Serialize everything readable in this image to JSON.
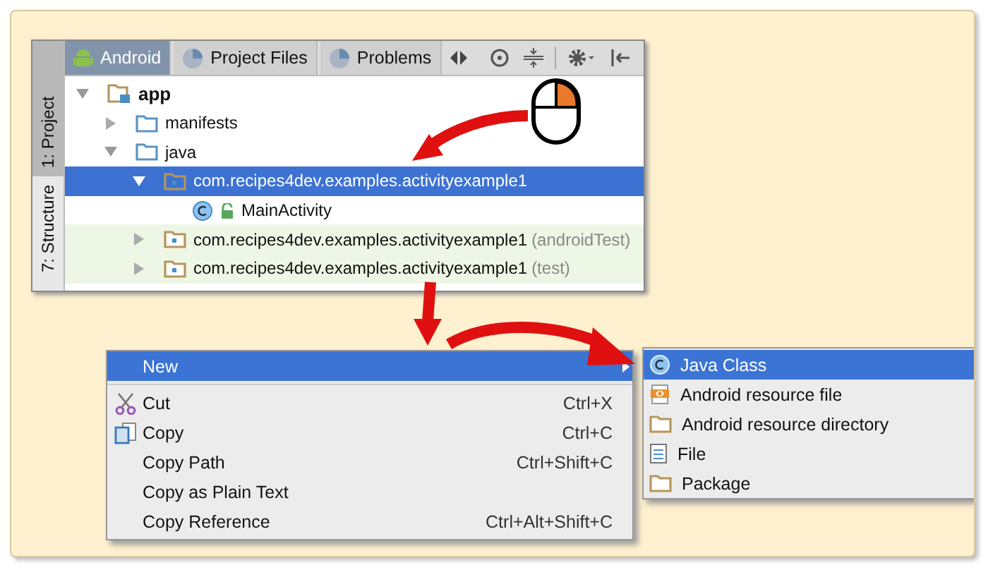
{
  "project_panel": {
    "side_tabs": [
      {
        "label": "1: Project",
        "selected": true
      },
      {
        "label": "7: Structure",
        "selected": false
      }
    ],
    "tabs": [
      {
        "label": "Android",
        "selected": true
      },
      {
        "label": "Project Files",
        "selected": false
      },
      {
        "label": "Problems",
        "selected": false
      }
    ],
    "tree": [
      {
        "label": "app",
        "kind": "module",
        "expanded": true,
        "selected": false,
        "children": [
          {
            "label": "manifests",
            "kind": "folder",
            "expanded": false,
            "selected": false
          },
          {
            "label": "java",
            "kind": "folder",
            "expanded": true,
            "selected": false,
            "children": [
              {
                "label": "com.recipes4dev.examples.activityexample1",
                "kind": "package",
                "expanded": true,
                "selected": true,
                "children": [
                  {
                    "label": "MainActivity",
                    "kind": "class",
                    "selected": false
                  }
                ]
              },
              {
                "label": "com.recipes4dev.examples.activityexample1",
                "suffix": "(androidTest)",
                "kind": "test_package",
                "expanded": false,
                "selected": false
              },
              {
                "label": "com.recipes4dev.examples.activityexample1",
                "suffix": "(test)",
                "kind": "test_package",
                "expanded": false,
                "selected": false
              }
            ]
          }
        ]
      }
    ]
  },
  "context_menu": [
    {
      "label": "New",
      "kind": "plain",
      "submenu": true,
      "selected": true
    },
    {
      "label": "Cut",
      "kind": "scissors",
      "shortcut": "Ctrl+X",
      "submenu": false,
      "selected": false
    },
    {
      "label": "Copy",
      "kind": "copy",
      "shortcut": "Ctrl+C",
      "submenu": false,
      "selected": false
    },
    {
      "label": "Copy Path",
      "kind": "plain",
      "shortcut": "Ctrl+Shift+C",
      "submenu": false,
      "selected": false
    },
    {
      "label": "Copy as Plain Text",
      "kind": "plain",
      "submenu": false,
      "selected": false
    },
    {
      "label": "Copy Reference",
      "kind": "plain",
      "shortcut": "Ctrl+Alt+Shift+C",
      "submenu": false,
      "selected": false
    }
  ],
  "submenu": [
    {
      "label": "Java Class",
      "kind": "class",
      "selected": true
    },
    {
      "label": "Android resource file",
      "kind": "resource",
      "selected": false
    },
    {
      "label": "Android resource directory",
      "kind": "folder",
      "selected": false
    },
    {
      "label": "File",
      "kind": "file",
      "selected": false
    },
    {
      "label": "Package",
      "kind": "folder",
      "selected": false
    }
  ]
}
